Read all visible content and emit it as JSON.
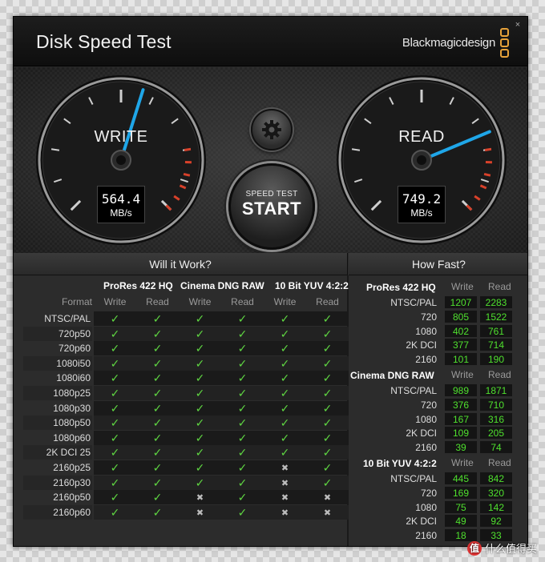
{
  "window": {
    "title": "Disk Speed Test",
    "brand": "Blackmagicdesign",
    "close_label": "×"
  },
  "gauges": {
    "scale_max_mbps": 1000,
    "write": {
      "label": "WRITE",
      "value": "564.4",
      "unit": "MB/s",
      "mbps": 564.4
    },
    "read": {
      "label": "READ",
      "value": "749.2",
      "unit": "MB/s",
      "mbps": 749.2
    }
  },
  "controls": {
    "start_sub": "SPEED TEST",
    "start_main": "START"
  },
  "colors": {
    "needle": "#1fa6e8",
    "ok_check": "#5fd642",
    "speed_value": "#4fe02e",
    "redline": "#d8412a",
    "brand_accent": "#e7a23a"
  },
  "will_it_work": {
    "title": "Will it Work?",
    "format_header": "Format",
    "groups": [
      "ProRes 422 HQ",
      "Cinema DNG RAW",
      "10 Bit YUV 4:2:2"
    ],
    "write_label": "Write",
    "read_label": "Read",
    "rows": [
      {
        "format": "NTSC/PAL",
        "cells": [
          1,
          1,
          1,
          1,
          1,
          1
        ]
      },
      {
        "format": "720p50",
        "cells": [
          1,
          1,
          1,
          1,
          1,
          1
        ]
      },
      {
        "format": "720p60",
        "cells": [
          1,
          1,
          1,
          1,
          1,
          1
        ]
      },
      {
        "format": "1080i50",
        "cells": [
          1,
          1,
          1,
          1,
          1,
          1
        ]
      },
      {
        "format": "1080i60",
        "cells": [
          1,
          1,
          1,
          1,
          1,
          1
        ]
      },
      {
        "format": "1080p25",
        "cells": [
          1,
          1,
          1,
          1,
          1,
          1
        ]
      },
      {
        "format": "1080p30",
        "cells": [
          1,
          1,
          1,
          1,
          1,
          1
        ]
      },
      {
        "format": "1080p50",
        "cells": [
          1,
          1,
          1,
          1,
          1,
          1
        ]
      },
      {
        "format": "1080p60",
        "cells": [
          1,
          1,
          1,
          1,
          1,
          1
        ]
      },
      {
        "format": "2K DCI 25",
        "cells": [
          1,
          1,
          1,
          1,
          1,
          1
        ]
      },
      {
        "format": "2160p25",
        "cells": [
          1,
          1,
          1,
          1,
          0,
          1
        ]
      },
      {
        "format": "2160p30",
        "cells": [
          1,
          1,
          1,
          1,
          0,
          1
        ]
      },
      {
        "format": "2160p50",
        "cells": [
          1,
          1,
          0,
          1,
          0,
          0
        ]
      },
      {
        "format": "2160p60",
        "cells": [
          1,
          1,
          0,
          1,
          0,
          0
        ]
      }
    ]
  },
  "how_fast": {
    "title": "How Fast?",
    "write_label": "Write",
    "read_label": "Read",
    "groups": [
      {
        "name": "ProRes 422 HQ",
        "rows": [
          {
            "format": "NTSC/PAL",
            "write": "1207",
            "read": "2283"
          },
          {
            "format": "720",
            "write": "805",
            "read": "1522"
          },
          {
            "format": "1080",
            "write": "402",
            "read": "761"
          },
          {
            "format": "2K DCI",
            "write": "377",
            "read": "714"
          },
          {
            "format": "2160",
            "write": "101",
            "read": "190"
          }
        ]
      },
      {
        "name": "Cinema DNG RAW",
        "rows": [
          {
            "format": "NTSC/PAL",
            "write": "989",
            "read": "1871"
          },
          {
            "format": "720",
            "write": "376",
            "read": "710"
          },
          {
            "format": "1080",
            "write": "167",
            "read": "316"
          },
          {
            "format": "2K DCI",
            "write": "109",
            "read": "205"
          },
          {
            "format": "2160",
            "write": "39",
            "read": "74"
          }
        ]
      },
      {
        "name": "10 Bit YUV 4:2:2",
        "rows": [
          {
            "format": "NTSC/PAL",
            "write": "445",
            "read": "842"
          },
          {
            "format": "720",
            "write": "169",
            "read": "320"
          },
          {
            "format": "1080",
            "write": "75",
            "read": "142"
          },
          {
            "format": "2K DCI",
            "write": "49",
            "read": "92"
          },
          {
            "format": "2160",
            "write": "18",
            "read": "33"
          }
        ]
      }
    ]
  },
  "watermark": {
    "badge": "值",
    "text": "什么值得买"
  }
}
